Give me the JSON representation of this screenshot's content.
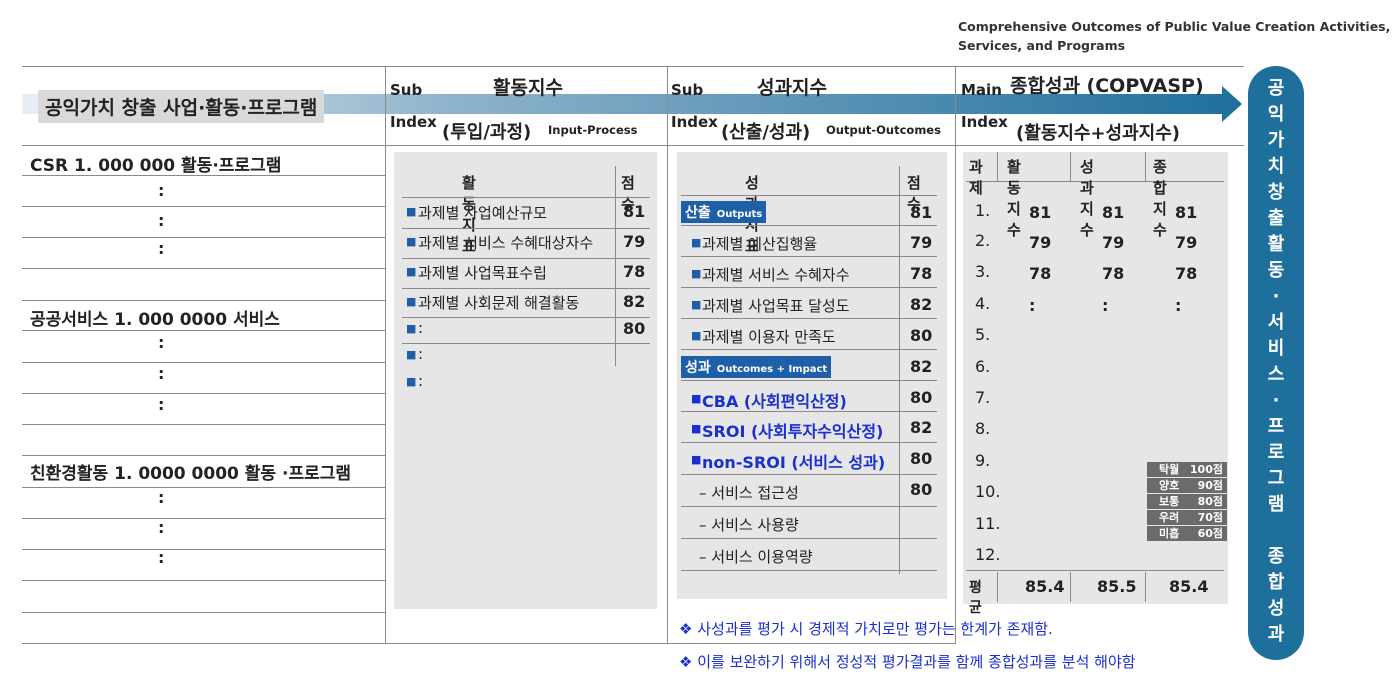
{
  "top_caption": [
    "Comprehensive Outcomes of Public Value Creation Activities,",
    "Services, and Programs"
  ],
  "header": {
    "arrow_label": "공익가치 창출 사업·활동·프로그램",
    "activity": {
      "sub": "Sub",
      "index": "Index",
      "title": "활동지수",
      "subtitle": "(투입/과정)",
      "en": "Input-Process"
    },
    "outcome": {
      "sub": "Sub",
      "index": "Index",
      "title": "성과지수",
      "subtitle": "(산출/성과)",
      "en": "Output-Outcomes"
    },
    "main": {
      "main": "Main",
      "index": "Index",
      "title": "종합성과 (COPVASP)",
      "subtitle": "(활동지수+성과지수)"
    }
  },
  "vertical_label": [
    "공",
    "익",
    "가",
    "치",
    "창",
    "출",
    "활",
    "동",
    "·",
    "서",
    "비",
    "스",
    "·",
    "프",
    "로",
    "그",
    "램",
    "",
    "종",
    "합",
    "성",
    "과"
  ],
  "left_rows": {
    "csr": "CSR 1. 000 000 활동·프로그램",
    "public": "공공서비스 1. 000 0000 서비스",
    "eco": "친환경활동 1. 0000 0000 활동 ·프로그램",
    "colon": ":"
  },
  "activity_table": {
    "col_indicator": "활동지표",
    "col_score": "점수",
    "rows": [
      {
        "label": "과제별 사업예산규모",
        "score": "81"
      },
      {
        "label": "과제별 서비스 수혜대상자수",
        "score": "79"
      },
      {
        "label": "과제별 사업목표수립",
        "score": "78"
      },
      {
        "label": "과제별 사회문제 해결활동",
        "score": "82"
      },
      {
        "label": ":",
        "score": "80"
      },
      {
        "label": ":",
        "score": ""
      },
      {
        "label": ":",
        "score": ""
      }
    ]
  },
  "outcome_table": {
    "col_indicator": "성과지표",
    "col_score": "점수",
    "outputs_tag": "산출",
    "outputs_tag_en": "Outputs",
    "outputs_tag_score": "81",
    "outputs": [
      {
        "label": "과제별 예산집행율",
        "score": "79"
      },
      {
        "label": "과제별 서비스 수혜자수",
        "score": "78"
      },
      {
        "label": "과제별 사업목표 달성도",
        "score": "82"
      },
      {
        "label": "과제별 이용자 만족도",
        "score": "80"
      }
    ],
    "outcomes_tag": "성과",
    "outcomes_tag_en": "Outcomes + Impact",
    "outcomes_tag_score": "82",
    "outcomes": [
      {
        "label": "CBA (사회편익산정)",
        "score": "80"
      },
      {
        "label": "SROI (사회투자수익산정)",
        "score": "82"
      },
      {
        "label": "non-SROI (서비스 성과)",
        "score": "80"
      }
    ],
    "sub_items": [
      {
        "label": "– 서비스 접근성",
        "score": "80"
      },
      {
        "label": "– 서비스 사용량",
        "score": ""
      },
      {
        "label": "– 서비스 이용역량",
        "score": ""
      }
    ]
  },
  "summary_table": {
    "headers": [
      "과제",
      "활동지수",
      "성과지수",
      "종합지수"
    ],
    "rows": [
      [
        "1.",
        "81",
        "81",
        "81"
      ],
      [
        "2.",
        "79",
        "79",
        "79"
      ],
      [
        "3.",
        "78",
        "78",
        "78"
      ],
      [
        "4.",
        ":",
        ":",
        ":"
      ],
      [
        "5.",
        "",
        "",
        ""
      ],
      [
        "6.",
        "",
        "",
        ""
      ],
      [
        "7.",
        "",
        "",
        ""
      ],
      [
        "8.",
        "",
        "",
        ""
      ],
      [
        "9.",
        "",
        "",
        ""
      ],
      [
        "10.",
        "",
        "",
        ""
      ],
      [
        "11.",
        "",
        "",
        ""
      ],
      [
        "12.",
        "",
        "",
        ""
      ]
    ],
    "avg": [
      "평균",
      "85.4",
      "85.5",
      "85.4"
    ],
    "grades": [
      {
        "name": "탁월",
        "score": "100점"
      },
      {
        "name": "양호",
        "score": "90점"
      },
      {
        "name": "보통",
        "score": "80점"
      },
      {
        "name": "우려",
        "score": "70점"
      },
      {
        "name": "미흡",
        "score": "60점"
      }
    ]
  },
  "notes": [
    "❖ 사성과를 평가 시 경제적 가치로만 평가는 한계가 존재함.",
    "❖ 이를 보완하기 위해서 정성적 평가결과를 함께 종합성과를 분석 해야함"
  ],
  "colors": {
    "accent_blue": "#1f6f9c",
    "tag_blue": "#1f5fa8",
    "note_blue": "#1a2fd0",
    "panel_gray": "#e6e6e6",
    "grade_gray": "#6b6b6b"
  }
}
